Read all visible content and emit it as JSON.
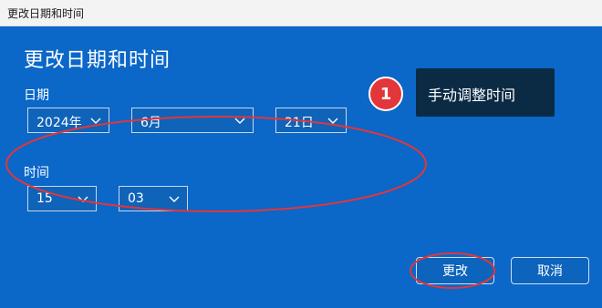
{
  "window": {
    "title": "更改日期和时间"
  },
  "dialog": {
    "heading": "更改日期和时间",
    "date_label": "日期",
    "year": "2024年",
    "month": "6月",
    "day": "21日",
    "time_label": "时间",
    "hour": "15",
    "minute": "03"
  },
  "annotation": {
    "step_number": "1",
    "callout_text": "手动调整时间",
    "accent_color": "#e2363a"
  },
  "buttons": {
    "change": "更改",
    "cancel": "取消"
  },
  "icons": {
    "dropdown": "chevron-down-icon"
  }
}
